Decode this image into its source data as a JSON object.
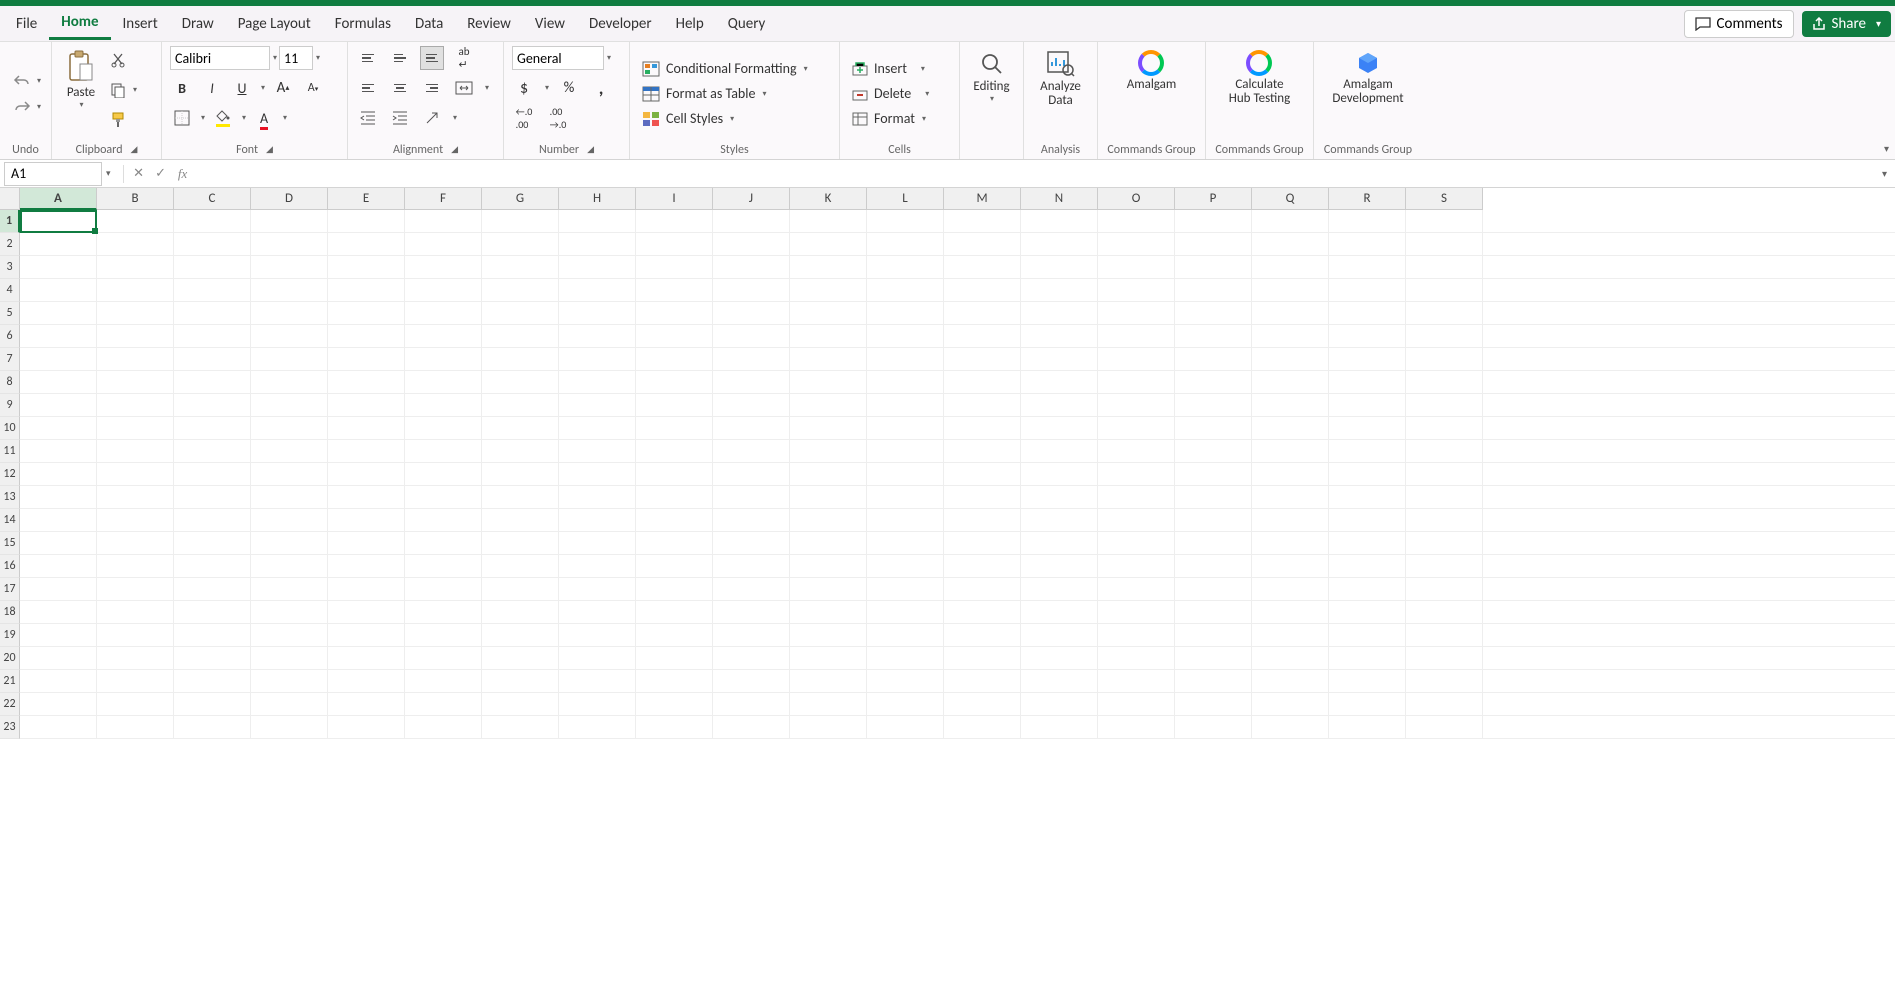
{
  "tabs": {
    "file": "File",
    "home": "Home",
    "insert": "Insert",
    "draw": "Draw",
    "page_layout": "Page Layout",
    "formulas": "Formulas",
    "data": "Data",
    "review": "Review",
    "view": "View",
    "developer": "Developer",
    "help": "Help",
    "query": "Query"
  },
  "header": {
    "comments": "Comments",
    "share": "Share"
  },
  "ribbon": {
    "undo_label": "Undo",
    "paste": "Paste",
    "clipboard_label": "Clipboard",
    "font_name": "Calibri",
    "font_size": "11",
    "font_label": "Font",
    "alignment_label": "Alignment",
    "number_format": "General",
    "number_label": "Number",
    "conditional_formatting": "Conditional Formatting",
    "format_as_table": "Format as Table",
    "cell_styles": "Cell Styles",
    "styles_label": "Styles",
    "insert": "Insert",
    "delete": "Delete",
    "format": "Format",
    "cells_label": "Cells",
    "editing": "Editing",
    "analyze_data": "Analyze\nData",
    "analysis_label": "Analysis",
    "amalgam": "Amalgam",
    "calculate_hub": "Calculate\nHub Testing",
    "amalgam_dev": "Amalgam\nDevelopment",
    "commands_group": "Commands Group"
  },
  "formula_bar": {
    "cell_ref": "A1",
    "formula": ""
  },
  "grid": {
    "columns": [
      "A",
      "B",
      "C",
      "D",
      "E",
      "F",
      "G",
      "H",
      "I",
      "J",
      "K",
      "L",
      "M",
      "N",
      "O",
      "P",
      "Q",
      "R",
      "S"
    ],
    "rows": [
      "1",
      "2",
      "3",
      "4",
      "5",
      "6",
      "7",
      "8",
      "9",
      "10",
      "11",
      "12",
      "13",
      "14",
      "15",
      "16",
      "17",
      "18",
      "19",
      "20",
      "21",
      "22",
      "23"
    ],
    "selected_col": "A",
    "selected_row": "1"
  }
}
